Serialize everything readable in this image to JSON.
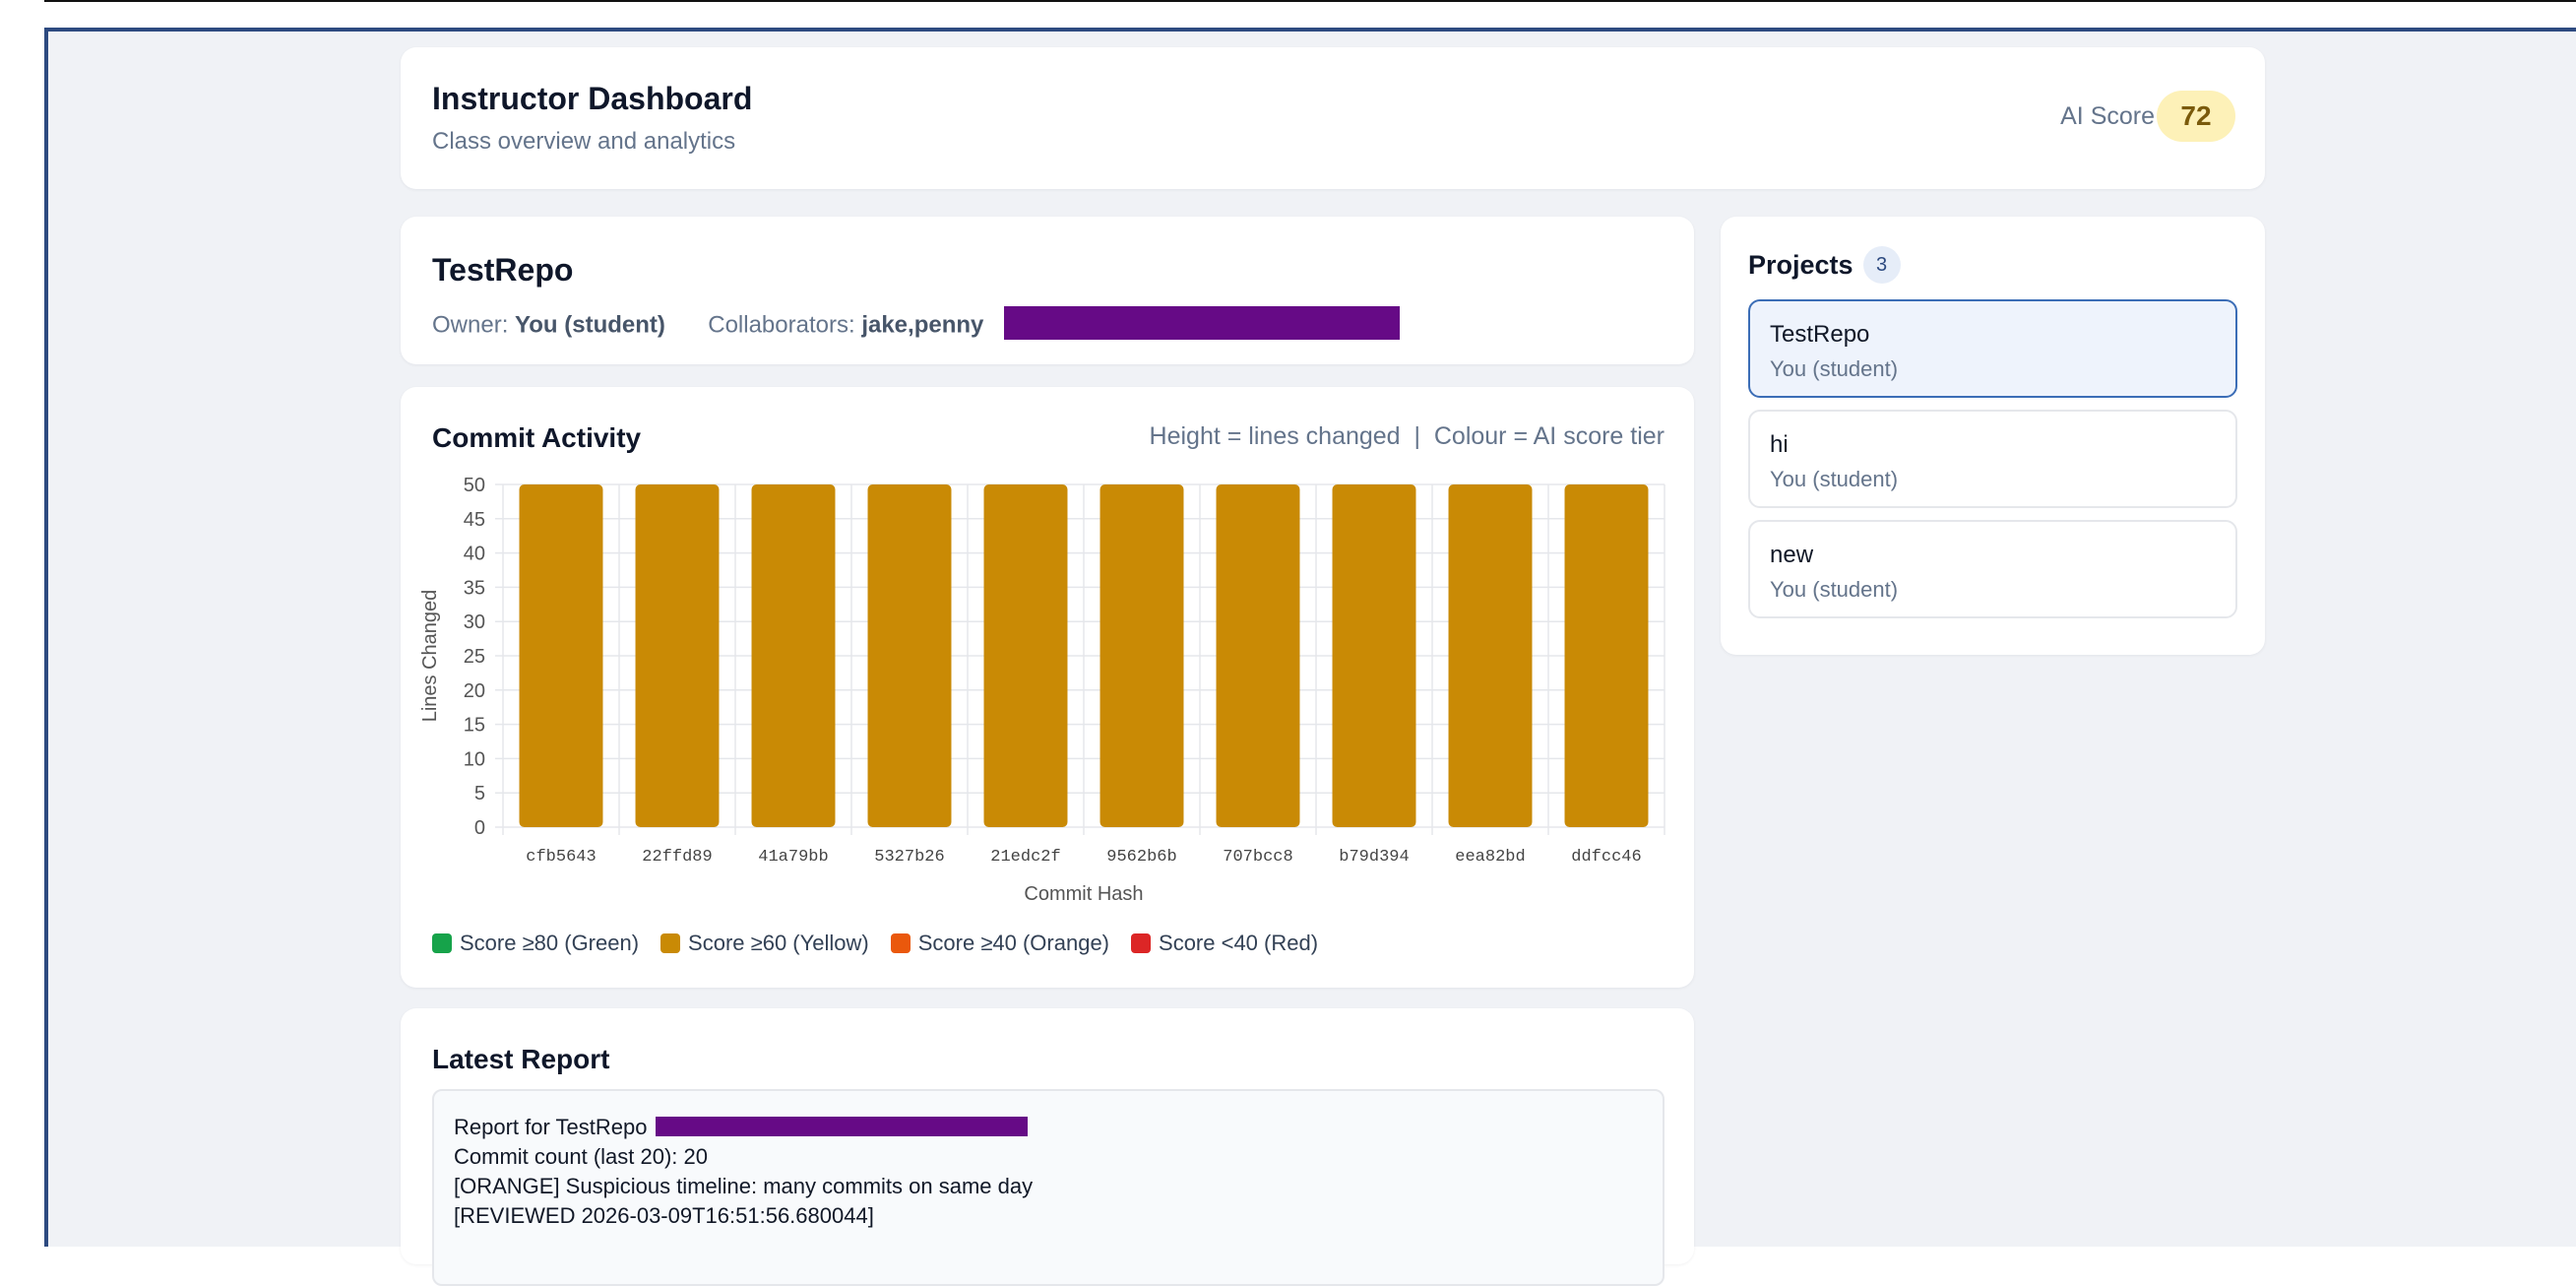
{
  "header": {
    "title": "Instructor Dashboard",
    "subtitle": "Class overview and analytics",
    "ai_score_label": "AI Score",
    "ai_score_value": "72"
  },
  "repo": {
    "name": "TestRepo",
    "owner_label": "Owner:",
    "owner_value": "You (student)",
    "collaborators_label": "Collaborators:",
    "collaborators_value": "jake,penny"
  },
  "commit_activity": {
    "title": "Commit Activity",
    "hint": "Height = lines changed  |  Colour = AI score tier"
  },
  "chart_data": {
    "type": "bar",
    "categories": [
      "cfb5643",
      "22ffd89",
      "41a79bb",
      "5327b26",
      "21edc2f",
      "9562b6b",
      "707bcc8",
      "b79d394",
      "eea82bd",
      "ddfcc46"
    ],
    "values": [
      50,
      50,
      50,
      50,
      50,
      50,
      50,
      50,
      50,
      50
    ],
    "bar_color": "#c98a05",
    "xlabel": "Commit Hash",
    "ylabel": "Lines Changed",
    "ylim": [
      0,
      50
    ],
    "yticks": [
      0,
      5,
      10,
      15,
      20,
      25,
      30,
      35,
      40,
      45,
      50
    ],
    "grid": true
  },
  "legend": [
    {
      "label": "Score ≥80 (Green)",
      "color": "#16a34a"
    },
    {
      "label": "Score ≥60 (Yellow)",
      "color": "#c98a05"
    },
    {
      "label": "Score ≥40 (Orange)",
      "color": "#ea580c"
    },
    {
      "label": "Score <40 (Red)",
      "color": "#dc2626"
    }
  ],
  "projects": {
    "title": "Projects",
    "count": "3",
    "items": [
      {
        "name": "TestRepo",
        "owner": "You (student)",
        "active": true
      },
      {
        "name": "hi",
        "owner": "You (student)",
        "active": false
      },
      {
        "name": "new",
        "owner": "You (student)",
        "active": false
      }
    ]
  },
  "report": {
    "title": "Latest Report",
    "line1": "Report for TestRepo",
    "line2": "Commit count (last 20): 20",
    "line3": "[ORANGE] Suspicious timeline: many commits on same day",
    "line4": "[REVIEWED 2026-03-09T16:51:56.680044]"
  }
}
